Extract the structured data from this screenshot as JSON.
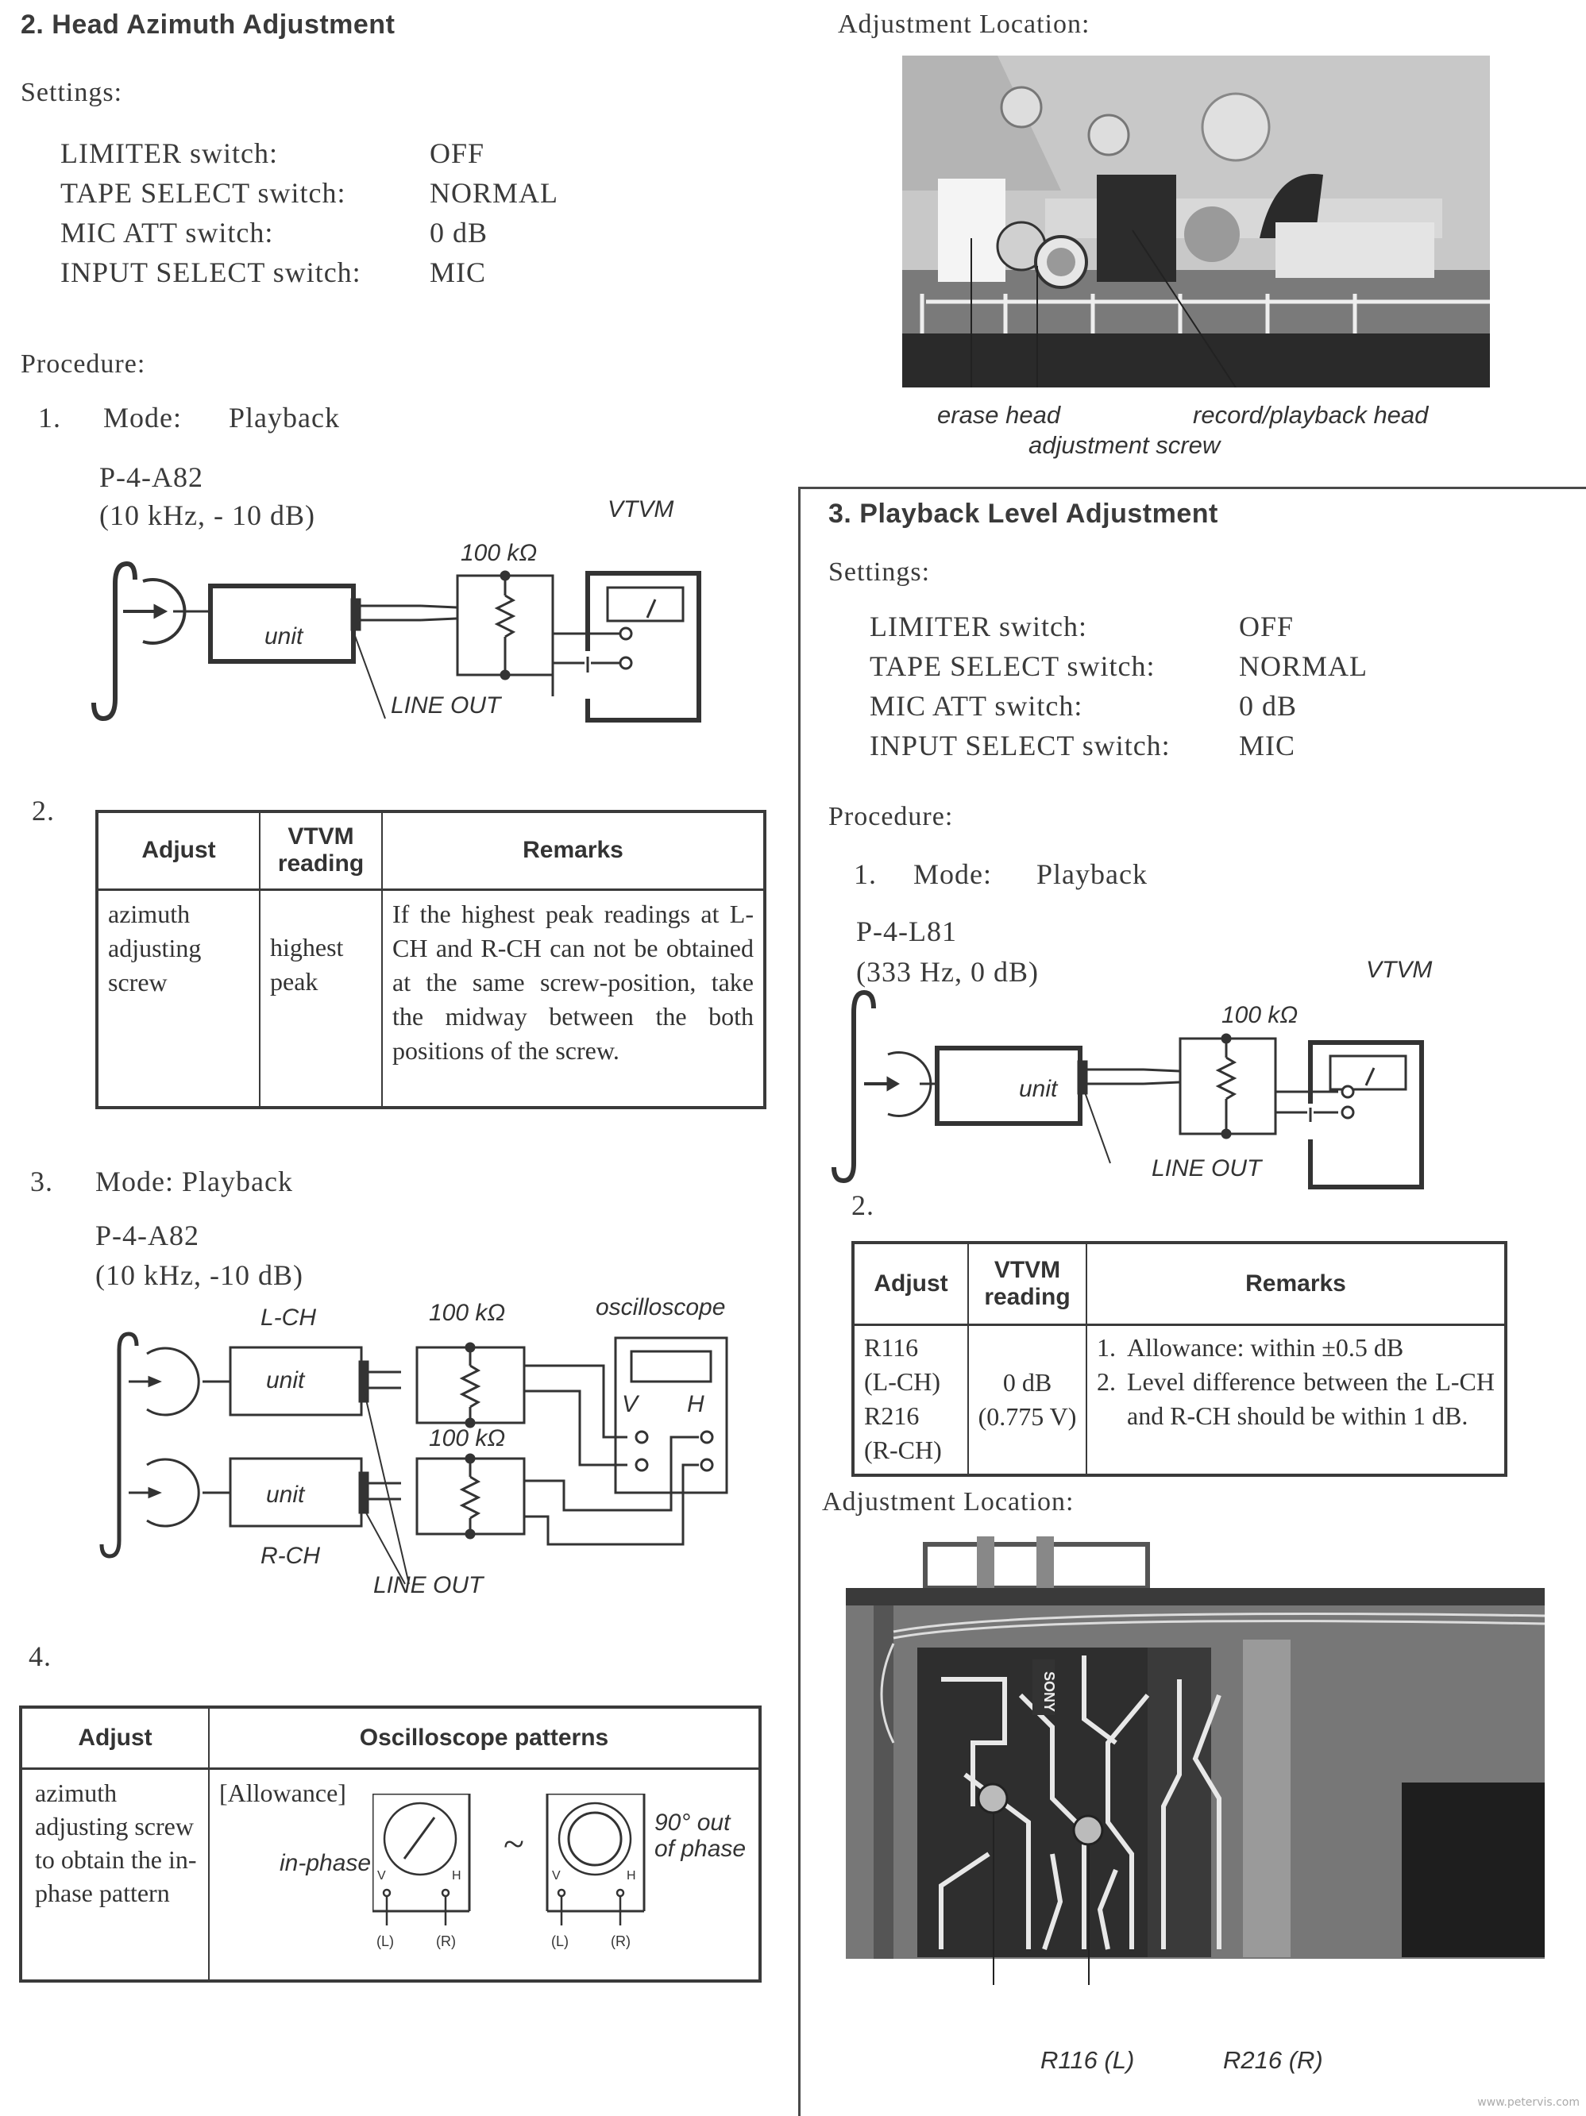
{
  "left": {
    "section_title": "2. Head Azimuth Adjustment",
    "settings_heading": "Settings:",
    "settings": [
      {
        "label": "LIMITER switch:",
        "value": "OFF"
      },
      {
        "label": "TAPE SELECT switch:",
        "value": "NORMAL"
      },
      {
        "label": "MIC ATT switch:",
        "value": "0 dB"
      },
      {
        "label": "INPUT SELECT switch:",
        "value": "MIC"
      }
    ],
    "procedure_heading": "Procedure:",
    "step1": {
      "number": "1.",
      "mode_label": "Mode:",
      "mode_value": "Playback",
      "tape": "P-4-A82",
      "tape_spec": "(10 kHz, - 10 dB)",
      "diagram": {
        "unit": "unit",
        "resistor": "100 kΩ",
        "meter": "VTVM",
        "output": "LINE OUT"
      }
    },
    "step2": {
      "number": "2.",
      "table": {
        "headers": [
          "Adjust",
          "VTVM reading",
          "Remarks"
        ],
        "rows": [
          [
            "azimuth adjusting screw",
            "highest peak",
            "If the highest peak readings at L-CH and R-CH can not be obtained at the same screw-position, take the midway between the both positions of the screw."
          ]
        ]
      }
    },
    "step3": {
      "number": "3.",
      "mode": "Mode: Playback",
      "tape": "P-4-A82",
      "tape_spec": "(10 kHz, -10 dB)",
      "diagram": {
        "lch": "L-CH",
        "rch": "R-CH",
        "unit": "unit",
        "resistor": "100 kΩ",
        "scope": "oscilloscope",
        "v": "V",
        "h": "H",
        "output": "LINE OUT"
      }
    },
    "step4": {
      "number": "4.",
      "table": {
        "headers": [
          "Adjust",
          "Oscilloscope patterns"
        ],
        "adjust": "azimuth adjusting screw to obtain the in-phase pattern",
        "allowance": "[Allowance]",
        "in_phase": "in-phase",
        "tilde": "~",
        "out_phase": "90° out of phase",
        "v": "V",
        "h": "H",
        "l": "(L)",
        "r": "(R)"
      }
    }
  },
  "right": {
    "location_heading": "Adjustment Location:",
    "photo1_labels": {
      "erase": "erase head",
      "screw": "adjustment screw",
      "rp_head": "record/playback head"
    },
    "section_title": "3. Playback Level Adjustment",
    "settings_heading": "Settings:",
    "settings": [
      {
        "label": "LIMITER switch:",
        "value": "OFF"
      },
      {
        "label": "TAPE SELECT switch:",
        "value": "NORMAL"
      },
      {
        "label": "MIC ATT switch:",
        "value": "0 dB"
      },
      {
        "label": "INPUT SELECT switch:",
        "value": "MIC"
      }
    ],
    "procedure_heading": "Procedure:",
    "step1": {
      "number": "1.",
      "mode_label": "Mode:",
      "mode_value": "Playback",
      "tape": "P-4-L81",
      "tape_spec": "(333 Hz, 0 dB)",
      "diagram": {
        "unit": "unit",
        "resistor": "100 kΩ",
        "meter": "VTVM",
        "output": "LINE OUT"
      }
    },
    "step2": {
      "number": "2.",
      "table": {
        "headers": [
          "Adjust",
          "VTVM reading",
          "Remarks"
        ],
        "adjust": [
          "R116",
          "(L-CH)",
          "R216",
          "(R-CH)"
        ],
        "reading": [
          "0 dB",
          "(0.775 V)"
        ],
        "remarks": [
          {
            "n": "1.",
            "text": "Allowance: within ±0.5 dB"
          },
          {
            "n": "2.",
            "text": "Level difference between the L-CH and R-CH should be within 1 dB."
          }
        ]
      }
    },
    "location_heading2": "Adjustment Location:",
    "photo2_labels": {
      "r116": "R116 (L)",
      "r216": "R216 (R)",
      "brand": "SONY"
    }
  },
  "watermark": "www.petervis.com"
}
